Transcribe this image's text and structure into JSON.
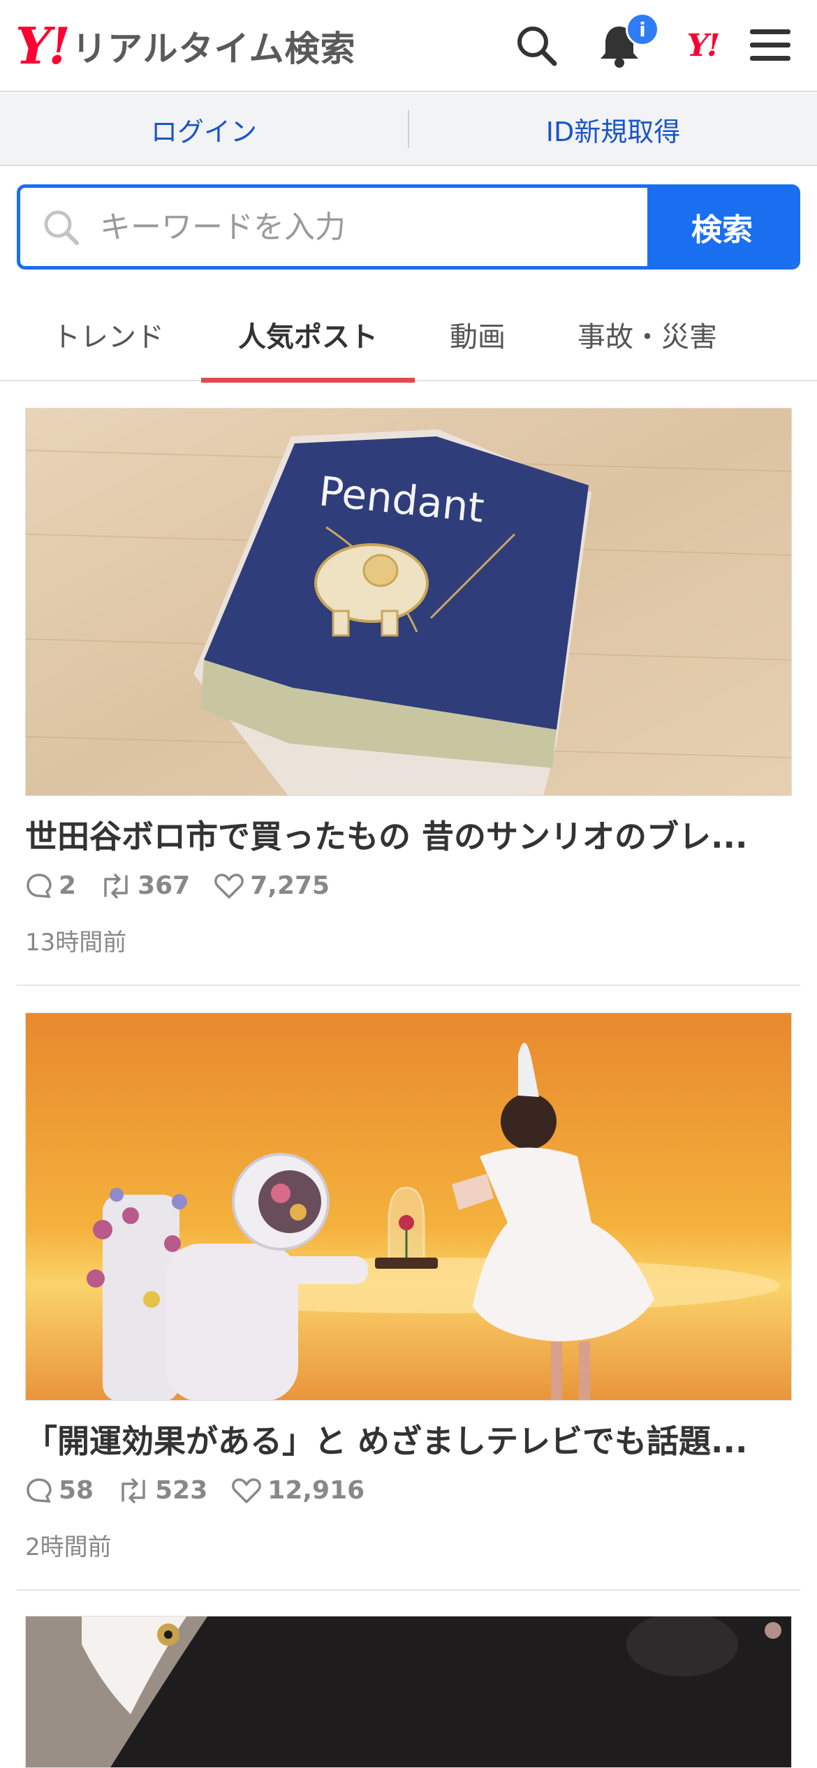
{
  "header": {
    "logo_mark": "Y!",
    "logo_text": "リアルタイム検索",
    "notification_badge": "i",
    "yahoo_mark": "Y!"
  },
  "loginbar": {
    "login": "ログイン",
    "register": "ID新規取得"
  },
  "search": {
    "placeholder": "キーワードを入力",
    "button": "検索"
  },
  "tabs": [
    {
      "label": "トレンド",
      "active": false
    },
    {
      "label": "人気ポスト",
      "active": true
    },
    {
      "label": "動画",
      "active": false
    },
    {
      "label": "事故・災害",
      "active": false
    }
  ],
  "posts": [
    {
      "title": "世田谷ボロ市で買ったもの 昔のサンリオのブレ...",
      "replies": "2",
      "reposts": "367",
      "likes": "7,275",
      "time": "13時間前",
      "image_text": "Pendant"
    },
    {
      "title": "「開運効果がある」と めざましテレビでも話題...",
      "replies": "58",
      "reposts": "523",
      "likes": "12,916",
      "time": "2時間前"
    }
  ],
  "colors": {
    "brand_red": "#ff0033",
    "link_blue": "#1a55c7",
    "accent_blue": "#1a6ff0",
    "tab_underline": "#e04a4a"
  }
}
